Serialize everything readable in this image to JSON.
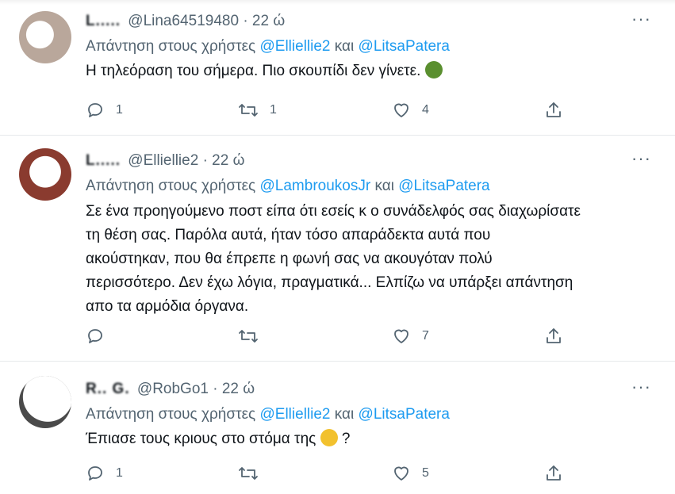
{
  "tweets": [
    {
      "name": "L.....",
      "handle": "@Lina64519480",
      "time": "· 22 ώ",
      "reply_prefix": "Απάντηση στους χρήστες",
      "mention1": "@Elliellie2",
      "reply_and": "και",
      "mention2": "@LitsaPatera",
      "text": "Η τηλεόραση του σήμερα. Πιο σκουπίδι δεν γίνετε.",
      "emoji_icon": "nauseated-face-emoji",
      "replies": "1",
      "retweets": "1",
      "likes": "4"
    },
    {
      "name": "L.....",
      "handle": "@Elliellie2",
      "time": "· 22 ώ",
      "reply_prefix": "Απάντηση στους χρήστες",
      "mention1": "@LambroukosJr",
      "reply_and": "και",
      "mention2": "@LitsaPatera",
      "text_lines": [
        "Σε ένα προηγούμενο ποστ είπα ότι εσείς κ ο συνάδελφός σας διαχωρίσατε",
        "τη θέση σας. Παρόλα αυτά, ήταν τόσο απαράδεκτα αυτά που",
        "ακούστηκαν, που θα έπρεπε η φωνή σας να ακουγόταν πολύ",
        "περισσότερο. Δεν έχω λόγια, πραγματικά... Ελπίζω να υπάρξει απάντηση",
        "απο τα αρμόδια όργανα."
      ],
      "replies": "",
      "retweets": "",
      "likes": "7"
    },
    {
      "name": "R.. G.",
      "handle": "@RobGo1",
      "time": "· 22 ώ",
      "reply_prefix": "Απάντηση στους χρήστες",
      "mention1": "@Elliellie2",
      "reply_and": "και",
      "mention2": "@LitsaPatera",
      "text": "Έπιασε τους κριους στο στόμα της",
      "text_suffix": "?",
      "emoji_icon": "angry-face-emoji",
      "replies": "1",
      "retweets": "",
      "likes": "5"
    }
  ],
  "more_label": "···",
  "colors": {
    "text": "#0f1419",
    "secondary": "#536471",
    "link": "#1d9bf0",
    "divider": "#e6e9eb"
  },
  "icons": [
    "reply-icon",
    "retweet-icon",
    "like-icon",
    "share-icon",
    "more-icon"
  ]
}
